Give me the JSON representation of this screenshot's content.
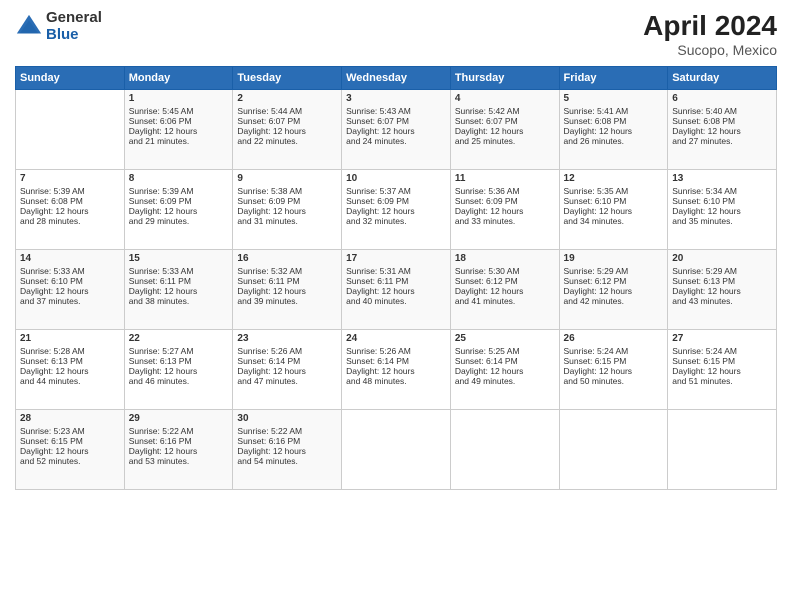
{
  "header": {
    "logo_general": "General",
    "logo_blue": "Blue",
    "month_title": "April 2024",
    "location": "Sucopo, Mexico"
  },
  "days_of_week": [
    "Sunday",
    "Monday",
    "Tuesday",
    "Wednesday",
    "Thursday",
    "Friday",
    "Saturday"
  ],
  "weeks": [
    [
      {
        "day": "",
        "info": ""
      },
      {
        "day": "1",
        "info": "Sunrise: 5:45 AM\nSunset: 6:06 PM\nDaylight: 12 hours\nand 21 minutes."
      },
      {
        "day": "2",
        "info": "Sunrise: 5:44 AM\nSunset: 6:07 PM\nDaylight: 12 hours\nand 22 minutes."
      },
      {
        "day": "3",
        "info": "Sunrise: 5:43 AM\nSunset: 6:07 PM\nDaylight: 12 hours\nand 24 minutes."
      },
      {
        "day": "4",
        "info": "Sunrise: 5:42 AM\nSunset: 6:07 PM\nDaylight: 12 hours\nand 25 minutes."
      },
      {
        "day": "5",
        "info": "Sunrise: 5:41 AM\nSunset: 6:08 PM\nDaylight: 12 hours\nand 26 minutes."
      },
      {
        "day": "6",
        "info": "Sunrise: 5:40 AM\nSunset: 6:08 PM\nDaylight: 12 hours\nand 27 minutes."
      }
    ],
    [
      {
        "day": "7",
        "info": "Sunrise: 5:39 AM\nSunset: 6:08 PM\nDaylight: 12 hours\nand 28 minutes."
      },
      {
        "day": "8",
        "info": "Sunrise: 5:39 AM\nSunset: 6:09 PM\nDaylight: 12 hours\nand 29 minutes."
      },
      {
        "day": "9",
        "info": "Sunrise: 5:38 AM\nSunset: 6:09 PM\nDaylight: 12 hours\nand 31 minutes."
      },
      {
        "day": "10",
        "info": "Sunrise: 5:37 AM\nSunset: 6:09 PM\nDaylight: 12 hours\nand 32 minutes."
      },
      {
        "day": "11",
        "info": "Sunrise: 5:36 AM\nSunset: 6:09 PM\nDaylight: 12 hours\nand 33 minutes."
      },
      {
        "day": "12",
        "info": "Sunrise: 5:35 AM\nSunset: 6:10 PM\nDaylight: 12 hours\nand 34 minutes."
      },
      {
        "day": "13",
        "info": "Sunrise: 5:34 AM\nSunset: 6:10 PM\nDaylight: 12 hours\nand 35 minutes."
      }
    ],
    [
      {
        "day": "14",
        "info": "Sunrise: 5:33 AM\nSunset: 6:10 PM\nDaylight: 12 hours\nand 37 minutes."
      },
      {
        "day": "15",
        "info": "Sunrise: 5:33 AM\nSunset: 6:11 PM\nDaylight: 12 hours\nand 38 minutes."
      },
      {
        "day": "16",
        "info": "Sunrise: 5:32 AM\nSunset: 6:11 PM\nDaylight: 12 hours\nand 39 minutes."
      },
      {
        "day": "17",
        "info": "Sunrise: 5:31 AM\nSunset: 6:11 PM\nDaylight: 12 hours\nand 40 minutes."
      },
      {
        "day": "18",
        "info": "Sunrise: 5:30 AM\nSunset: 6:12 PM\nDaylight: 12 hours\nand 41 minutes."
      },
      {
        "day": "19",
        "info": "Sunrise: 5:29 AM\nSunset: 6:12 PM\nDaylight: 12 hours\nand 42 minutes."
      },
      {
        "day": "20",
        "info": "Sunrise: 5:29 AM\nSunset: 6:13 PM\nDaylight: 12 hours\nand 43 minutes."
      }
    ],
    [
      {
        "day": "21",
        "info": "Sunrise: 5:28 AM\nSunset: 6:13 PM\nDaylight: 12 hours\nand 44 minutes."
      },
      {
        "day": "22",
        "info": "Sunrise: 5:27 AM\nSunset: 6:13 PM\nDaylight: 12 hours\nand 46 minutes."
      },
      {
        "day": "23",
        "info": "Sunrise: 5:26 AM\nSunset: 6:14 PM\nDaylight: 12 hours\nand 47 minutes."
      },
      {
        "day": "24",
        "info": "Sunrise: 5:26 AM\nSunset: 6:14 PM\nDaylight: 12 hours\nand 48 minutes."
      },
      {
        "day": "25",
        "info": "Sunrise: 5:25 AM\nSunset: 6:14 PM\nDaylight: 12 hours\nand 49 minutes."
      },
      {
        "day": "26",
        "info": "Sunrise: 5:24 AM\nSunset: 6:15 PM\nDaylight: 12 hours\nand 50 minutes."
      },
      {
        "day": "27",
        "info": "Sunrise: 5:24 AM\nSunset: 6:15 PM\nDaylight: 12 hours\nand 51 minutes."
      }
    ],
    [
      {
        "day": "28",
        "info": "Sunrise: 5:23 AM\nSunset: 6:15 PM\nDaylight: 12 hours\nand 52 minutes."
      },
      {
        "day": "29",
        "info": "Sunrise: 5:22 AM\nSunset: 6:16 PM\nDaylight: 12 hours\nand 53 minutes."
      },
      {
        "day": "30",
        "info": "Sunrise: 5:22 AM\nSunset: 6:16 PM\nDaylight: 12 hours\nand 54 minutes."
      },
      {
        "day": "",
        "info": ""
      },
      {
        "day": "",
        "info": ""
      },
      {
        "day": "",
        "info": ""
      },
      {
        "day": "",
        "info": ""
      }
    ]
  ]
}
